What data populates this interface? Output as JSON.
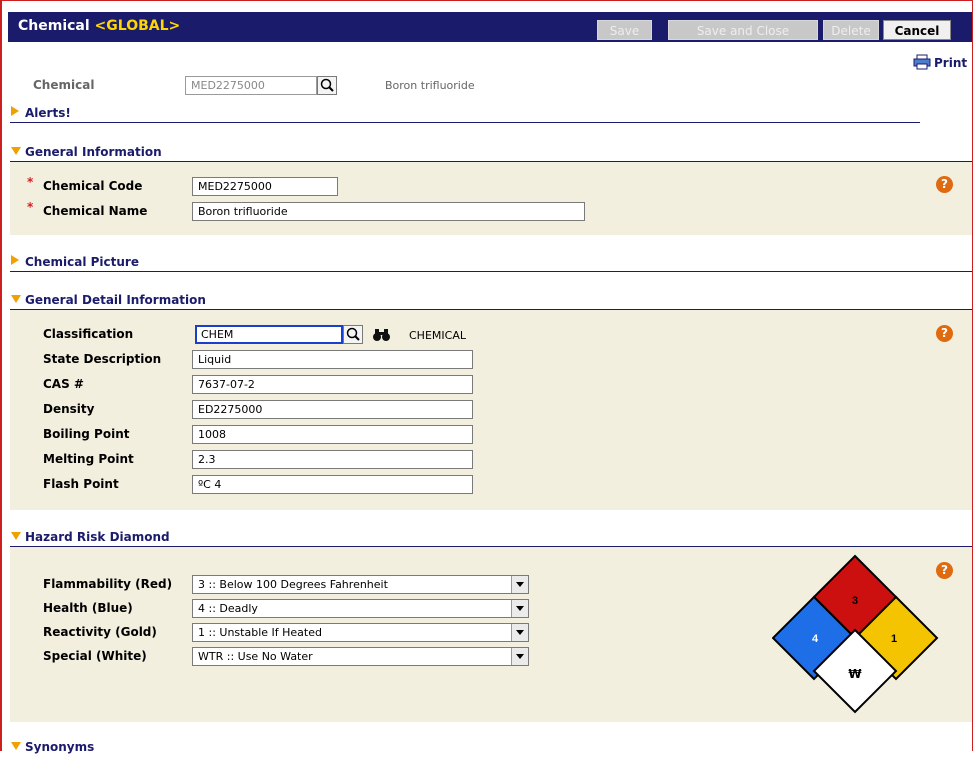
{
  "header": {
    "title": "Chemical",
    "scope": "<GLOBAL>",
    "buttons": {
      "save": "Save",
      "save_close": "Save and Close",
      "delete": "Delete",
      "cancel": "Cancel"
    }
  },
  "print_label": "Print",
  "top": {
    "chemical_label": "Chemical",
    "chemical_code": "MED2275000",
    "chemical_name": "Boron trifluoride"
  },
  "sections": {
    "alerts": "Alerts!",
    "general": "General Information",
    "picture": "Chemical Picture",
    "detail": "General Detail Information",
    "hazard": "Hazard Risk Diamond",
    "synonyms": "Synonyms"
  },
  "general": {
    "code_label": "Chemical Code",
    "code_value": "MED2275000",
    "name_label": "Chemical Name",
    "name_value": "Boron trifluoride",
    "required_mark": "*"
  },
  "detail": {
    "classification_label": "Classification",
    "classification_value": "CHEM",
    "classification_desc": "CHEMICAL",
    "fields": [
      {
        "label": "State Description",
        "value": "Liquid"
      },
      {
        "label": "CAS #",
        "value": "7637-07-2"
      },
      {
        "label": "Density",
        "value": "ED2275000"
      },
      {
        "label": "Boiling Point",
        "value": "1008"
      },
      {
        "label": "Melting Point",
        "value": "2.3"
      },
      {
        "label": "Flash Point",
        "value": "ºC 4"
      }
    ]
  },
  "hazard": {
    "rows": [
      {
        "label": "Flammability (Red)",
        "value": "3 :: Below 100 Degrees Fahrenheit"
      },
      {
        "label": "Health (Blue)",
        "value": "4 :: Deadly"
      },
      {
        "label": "Reactivity (Gold)",
        "value": "1 :: Unstable If Heated"
      },
      {
        "label": "Special (White)",
        "value": "WTR :: Use No Water"
      }
    ],
    "diamond": {
      "flammability": "3",
      "health": "4",
      "reactivity": "1",
      "special": "₩",
      "colors": {
        "red": "#cc1010",
        "blue": "#1e6ee8",
        "gold": "#f5c400",
        "white": "#ffffff"
      }
    }
  },
  "help_glyph": "?",
  "icons": {
    "lookup": "magnifier-icon",
    "binoculars": "binoculars-icon",
    "printer": "printer-icon",
    "help": "help-icon"
  }
}
